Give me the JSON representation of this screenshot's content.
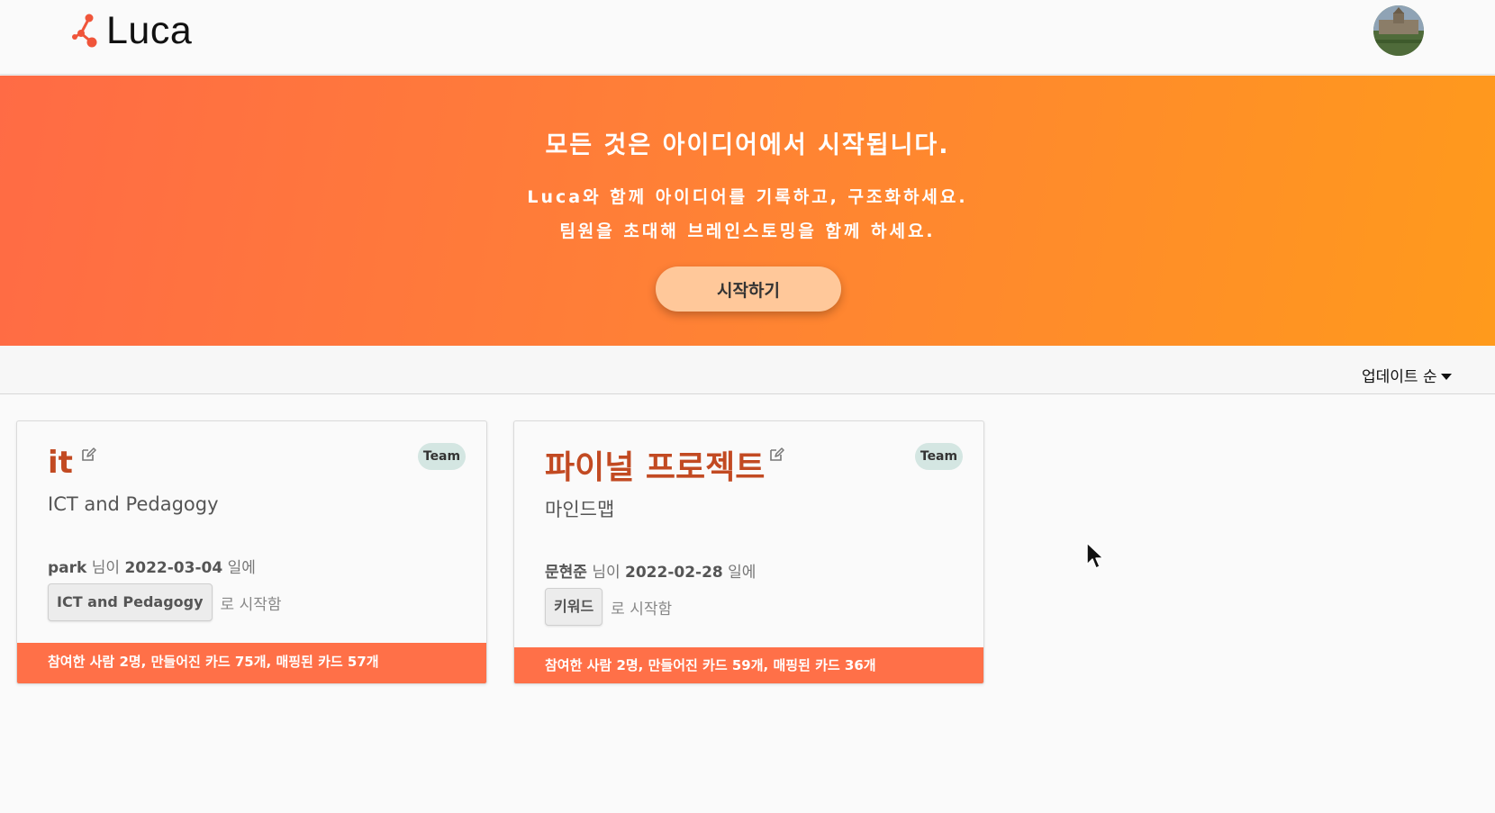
{
  "header": {
    "logo_text": "Luca",
    "logo_color": "#f0553a"
  },
  "hero": {
    "title": "모든 것은 아이디어에서 시작됩니다.",
    "subtitle_line1": "Luca와 함께 아이디어를 기록하고, 구조화하세요.",
    "subtitle_line2": "팀원을 초대해 브레인스토밍을 함께 하세요.",
    "start_button": "시작하기",
    "gradient_colors": [
      "#ff6b45",
      "#ff9a1c"
    ]
  },
  "sort": {
    "label": "업데이트 순"
  },
  "cards": [
    {
      "title": "it",
      "badge": "Team",
      "subtitle": "ICT and Pedagogy",
      "author": "park",
      "author_suffix": "님이",
      "date": "2022-03-04",
      "date_suffix": "일에",
      "keyword": "ICT and Pedagogy",
      "keyword_suffix": "로 시작함",
      "footer": "참여한 사람 2명, 만들어진 카드 75개, 매핑된 카드 57개"
    },
    {
      "title": "파이널 프로젝트",
      "badge": "Team",
      "subtitle": "마인드맵",
      "author": "문현준",
      "author_suffix": "님이",
      "date": "2022-02-28",
      "date_suffix": "일에",
      "keyword": "키워드",
      "keyword_suffix": "로 시작함",
      "footer": "참여한 사람 2명, 만들어진 카드 59개, 매핑된 카드 36개"
    }
  ],
  "colors": {
    "accent": "#ff7048",
    "title": "#c24a22",
    "badge_bg": "#d4e6e2"
  },
  "icons": {
    "edit": "pencil-square-icon",
    "sort": "caret-down-icon",
    "logo": "molecule-logo-icon",
    "cursor": "mouse-pointer-icon"
  }
}
